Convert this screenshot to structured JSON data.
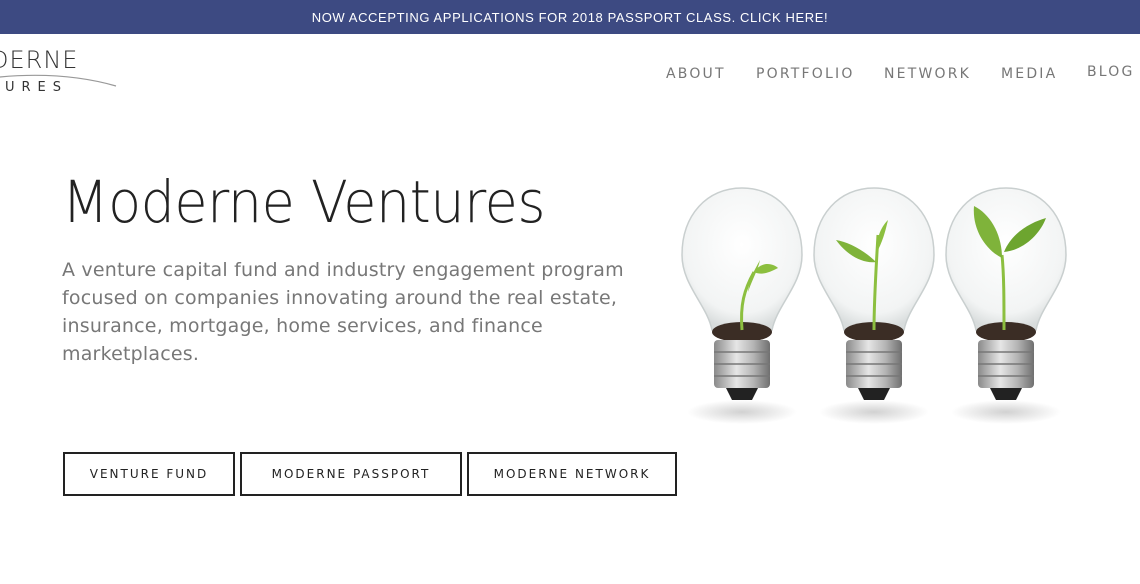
{
  "banner": {
    "text": "NOW ACCEPTING APPLICATIONS FOR 2018 PASSPORT CLASS. CLICK HERE!"
  },
  "logo": {
    "line1": "DERNE",
    "line2": "TURES"
  },
  "nav": {
    "items": [
      {
        "label": "ABOUT"
      },
      {
        "label": "PORTFOLIO"
      },
      {
        "label": "NETWORK"
      },
      {
        "label": "MEDIA"
      },
      {
        "label": "BLOG"
      }
    ]
  },
  "hero": {
    "title": "Moderne Ventures",
    "description": "A venture capital fund and industry engagement program focused on companies innovating around the real estate, insurance, mortgage, home services, and finance marketplaces."
  },
  "buttons": [
    {
      "label": "VENTURE FUND"
    },
    {
      "label": "MODERNE PASSPORT"
    },
    {
      "label": "MODERNE NETWORK"
    }
  ],
  "colors": {
    "banner_bg": "#3d4a82",
    "text_dark": "#222222",
    "text_muted": "#777777",
    "leaf_green": "#8cbf3f"
  },
  "image": {
    "icon": "lightbulb-sprout-illustration"
  }
}
